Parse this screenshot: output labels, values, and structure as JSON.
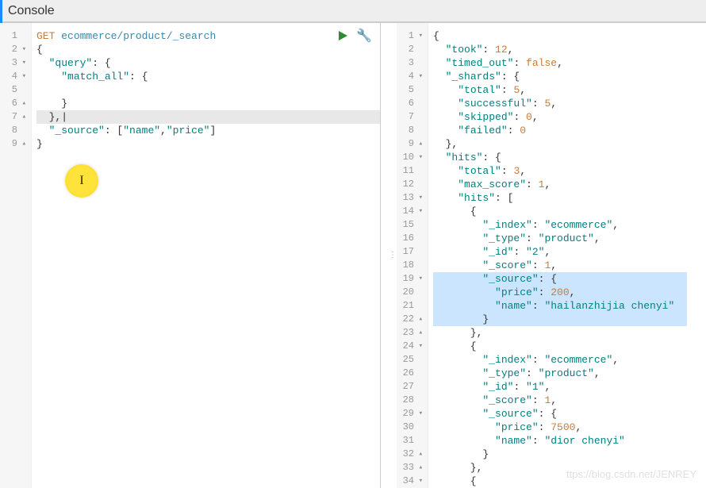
{
  "header": {
    "title": "Console"
  },
  "toolbox": {
    "run": "run-request",
    "wrench": "settings"
  },
  "highlight": {
    "cursor_glyph": "I"
  },
  "watermark": "ttps://blog.csdn.net/JENREY",
  "request": {
    "lines": [
      {
        "num": "1",
        "fold": "",
        "segs": [
          [
            "method",
            "GET"
          ],
          [
            "punct",
            " "
          ],
          [
            "path",
            "ecommerce/product/_search"
          ]
        ]
      },
      {
        "num": "2",
        "fold": "▾",
        "segs": [
          [
            "punct",
            "{"
          ]
        ]
      },
      {
        "num": "3",
        "fold": "▾",
        "segs": [
          [
            "punct",
            "  "
          ],
          [
            "key",
            "\"query\""
          ],
          [
            "punct",
            ": {"
          ]
        ]
      },
      {
        "num": "4",
        "fold": "▾",
        "segs": [
          [
            "punct",
            "    "
          ],
          [
            "key",
            "\"match_all\""
          ],
          [
            "punct",
            ": {"
          ]
        ]
      },
      {
        "num": "5",
        "fold": "",
        "segs": [
          [
            "punct",
            ""
          ]
        ]
      },
      {
        "num": "6",
        "fold": "▴",
        "segs": [
          [
            "punct",
            "    }"
          ]
        ]
      },
      {
        "num": "7",
        "fold": "▴",
        "segs": [
          [
            "punct",
            "  },"
          ]
        ],
        "active": true,
        "cursor_after": true
      },
      {
        "num": "8",
        "fold": "",
        "segs": [
          [
            "punct",
            "  "
          ],
          [
            "key",
            "\"_source\""
          ],
          [
            "punct",
            ": ["
          ],
          [
            "string",
            "\"name\""
          ],
          [
            "punct",
            ","
          ],
          [
            "string",
            "\"price\""
          ],
          [
            "punct",
            "]"
          ]
        ]
      },
      {
        "num": "9",
        "fold": "▴",
        "segs": [
          [
            "punct",
            "}"
          ]
        ]
      }
    ]
  },
  "response": {
    "selection": {
      "from": 19,
      "to": 22
    },
    "lines": [
      {
        "num": "1",
        "fold": "▾",
        "segs": [
          [
            "punct",
            "{"
          ]
        ]
      },
      {
        "num": "2",
        "fold": "",
        "segs": [
          [
            "punct",
            "  "
          ],
          [
            "key",
            "\"took\""
          ],
          [
            "punct",
            ": "
          ],
          [
            "number",
            "12"
          ],
          [
            "punct",
            ","
          ]
        ]
      },
      {
        "num": "3",
        "fold": "",
        "segs": [
          [
            "punct",
            "  "
          ],
          [
            "key",
            "\"timed_out\""
          ],
          [
            "punct",
            ": "
          ],
          [
            "bool",
            "false"
          ],
          [
            "punct",
            ","
          ]
        ]
      },
      {
        "num": "4",
        "fold": "▾",
        "segs": [
          [
            "punct",
            "  "
          ],
          [
            "key",
            "\"_shards\""
          ],
          [
            "punct",
            ": {"
          ]
        ]
      },
      {
        "num": "5",
        "fold": "",
        "segs": [
          [
            "punct",
            "    "
          ],
          [
            "key",
            "\"total\""
          ],
          [
            "punct",
            ": "
          ],
          [
            "number",
            "5"
          ],
          [
            "punct",
            ","
          ]
        ]
      },
      {
        "num": "6",
        "fold": "",
        "segs": [
          [
            "punct",
            "    "
          ],
          [
            "key",
            "\"successful\""
          ],
          [
            "punct",
            ": "
          ],
          [
            "number",
            "5"
          ],
          [
            "punct",
            ","
          ]
        ]
      },
      {
        "num": "7",
        "fold": "",
        "segs": [
          [
            "punct",
            "    "
          ],
          [
            "key",
            "\"skipped\""
          ],
          [
            "punct",
            ": "
          ],
          [
            "number",
            "0"
          ],
          [
            "punct",
            ","
          ]
        ]
      },
      {
        "num": "8",
        "fold": "",
        "segs": [
          [
            "punct",
            "    "
          ],
          [
            "key",
            "\"failed\""
          ],
          [
            "punct",
            ": "
          ],
          [
            "number",
            "0"
          ]
        ]
      },
      {
        "num": "9",
        "fold": "▴",
        "segs": [
          [
            "punct",
            "  },"
          ]
        ]
      },
      {
        "num": "10",
        "fold": "▾",
        "segs": [
          [
            "punct",
            "  "
          ],
          [
            "key",
            "\"hits\""
          ],
          [
            "punct",
            ": {"
          ]
        ]
      },
      {
        "num": "11",
        "fold": "",
        "segs": [
          [
            "punct",
            "    "
          ],
          [
            "key",
            "\"total\""
          ],
          [
            "punct",
            ": "
          ],
          [
            "number",
            "3"
          ],
          [
            "punct",
            ","
          ]
        ]
      },
      {
        "num": "12",
        "fold": "",
        "segs": [
          [
            "punct",
            "    "
          ],
          [
            "key",
            "\"max_score\""
          ],
          [
            "punct",
            ": "
          ],
          [
            "number",
            "1"
          ],
          [
            "punct",
            ","
          ]
        ]
      },
      {
        "num": "13",
        "fold": "▾",
        "segs": [
          [
            "punct",
            "    "
          ],
          [
            "key",
            "\"hits\""
          ],
          [
            "punct",
            ": ["
          ]
        ]
      },
      {
        "num": "14",
        "fold": "▾",
        "segs": [
          [
            "punct",
            "      {"
          ]
        ]
      },
      {
        "num": "15",
        "fold": "",
        "segs": [
          [
            "punct",
            "        "
          ],
          [
            "key",
            "\"_index\""
          ],
          [
            "punct",
            ": "
          ],
          [
            "string",
            "\"ecommerce\""
          ],
          [
            "punct",
            ","
          ]
        ]
      },
      {
        "num": "16",
        "fold": "",
        "segs": [
          [
            "punct",
            "        "
          ],
          [
            "key",
            "\"_type\""
          ],
          [
            "punct",
            ": "
          ],
          [
            "string",
            "\"product\""
          ],
          [
            "punct",
            ","
          ]
        ]
      },
      {
        "num": "17",
        "fold": "",
        "segs": [
          [
            "punct",
            "        "
          ],
          [
            "key",
            "\"_id\""
          ],
          [
            "punct",
            ": "
          ],
          [
            "string",
            "\"2\""
          ],
          [
            "punct",
            ","
          ]
        ]
      },
      {
        "num": "18",
        "fold": "",
        "segs": [
          [
            "punct",
            "        "
          ],
          [
            "key",
            "\"_score\""
          ],
          [
            "punct",
            ": "
          ],
          [
            "number",
            "1"
          ],
          [
            "punct",
            ","
          ]
        ]
      },
      {
        "num": "19",
        "fold": "▾",
        "segs": [
          [
            "punct",
            "        "
          ],
          [
            "key",
            "\"_source\""
          ],
          [
            "punct",
            ": {"
          ]
        ],
        "selected": true
      },
      {
        "num": "20",
        "fold": "",
        "segs": [
          [
            "punct",
            "          "
          ],
          [
            "key",
            "\"price\""
          ],
          [
            "punct",
            ": "
          ],
          [
            "number",
            "200"
          ],
          [
            "punct",
            ","
          ]
        ],
        "selected": true
      },
      {
        "num": "21",
        "fold": "",
        "segs": [
          [
            "punct",
            "          "
          ],
          [
            "key",
            "\"name\""
          ],
          [
            "punct",
            ": "
          ],
          [
            "string",
            "\"hailanzhijia chenyi\""
          ]
        ],
        "selected": true
      },
      {
        "num": "22",
        "fold": "▴",
        "segs": [
          [
            "punct",
            "        }"
          ]
        ],
        "selected": true
      },
      {
        "num": "23",
        "fold": "▴",
        "segs": [
          [
            "punct",
            "      },"
          ]
        ]
      },
      {
        "num": "24",
        "fold": "▾",
        "segs": [
          [
            "punct",
            "      {"
          ]
        ]
      },
      {
        "num": "25",
        "fold": "",
        "segs": [
          [
            "punct",
            "        "
          ],
          [
            "key",
            "\"_index\""
          ],
          [
            "punct",
            ": "
          ],
          [
            "string",
            "\"ecommerce\""
          ],
          [
            "punct",
            ","
          ]
        ]
      },
      {
        "num": "26",
        "fold": "",
        "segs": [
          [
            "punct",
            "        "
          ],
          [
            "key",
            "\"_type\""
          ],
          [
            "punct",
            ": "
          ],
          [
            "string",
            "\"product\""
          ],
          [
            "punct",
            ","
          ]
        ]
      },
      {
        "num": "27",
        "fold": "",
        "segs": [
          [
            "punct",
            "        "
          ],
          [
            "key",
            "\"_id\""
          ],
          [
            "punct",
            ": "
          ],
          [
            "string",
            "\"1\""
          ],
          [
            "punct",
            ","
          ]
        ]
      },
      {
        "num": "28",
        "fold": "",
        "segs": [
          [
            "punct",
            "        "
          ],
          [
            "key",
            "\"_score\""
          ],
          [
            "punct",
            ": "
          ],
          [
            "number",
            "1"
          ],
          [
            "punct",
            ","
          ]
        ]
      },
      {
        "num": "29",
        "fold": "▾",
        "segs": [
          [
            "punct",
            "        "
          ],
          [
            "key",
            "\"_source\""
          ],
          [
            "punct",
            ": {"
          ]
        ]
      },
      {
        "num": "30",
        "fold": "",
        "segs": [
          [
            "punct",
            "          "
          ],
          [
            "key",
            "\"price\""
          ],
          [
            "punct",
            ": "
          ],
          [
            "number",
            "7500"
          ],
          [
            "punct",
            ","
          ]
        ]
      },
      {
        "num": "31",
        "fold": "",
        "segs": [
          [
            "punct",
            "          "
          ],
          [
            "key",
            "\"name\""
          ],
          [
            "punct",
            ": "
          ],
          [
            "string",
            "\"dior chenyi\""
          ]
        ]
      },
      {
        "num": "32",
        "fold": "▴",
        "segs": [
          [
            "punct",
            "        }"
          ]
        ]
      },
      {
        "num": "33",
        "fold": "▴",
        "segs": [
          [
            "punct",
            "      },"
          ]
        ]
      },
      {
        "num": "34",
        "fold": "▾",
        "segs": [
          [
            "punct",
            "      {"
          ]
        ]
      }
    ]
  }
}
